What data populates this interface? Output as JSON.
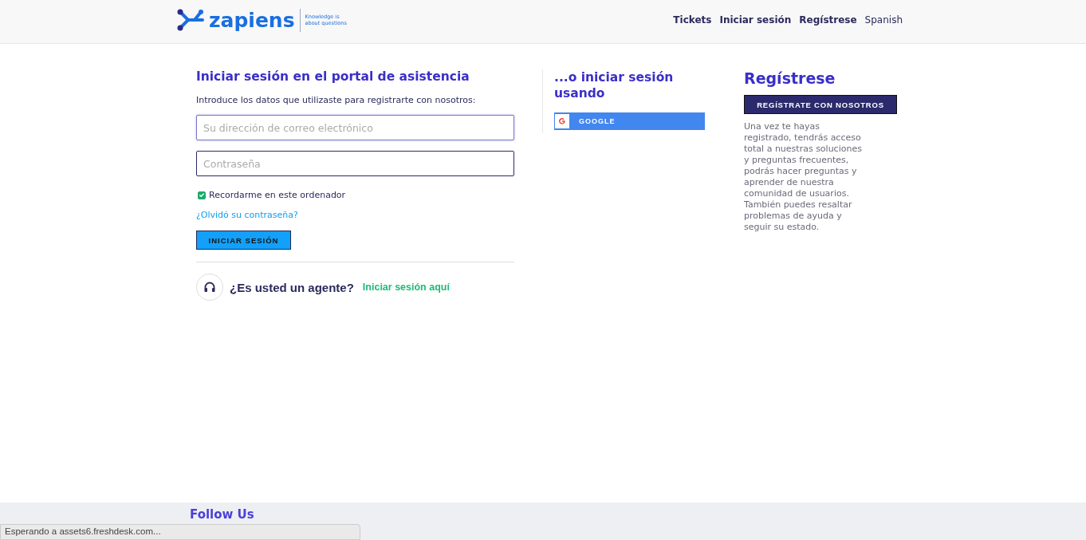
{
  "header": {
    "logo": {
      "name": "zapiens",
      "tagline": [
        "Knowledge is",
        "about questions"
      ]
    },
    "nav": [
      {
        "label": "Tickets",
        "kind": "link"
      },
      {
        "label": "Iniciar sesión",
        "kind": "link"
      },
      {
        "label": "Regístrese",
        "kind": "link"
      },
      {
        "label": "Spanish",
        "kind": "language"
      }
    ]
  },
  "login": {
    "title": "Iniciar sesión en el portal de asistencia",
    "intro": "Introduce los datos que utilizaste para registrarte con nosotros:",
    "email": {
      "placeholder": "Su dirección de correo electrónico"
    },
    "password": {
      "placeholder": "Contraseña"
    },
    "remember": {
      "label": "Recordarme en este ordenador",
      "checked": true
    },
    "forgot": "¿Olvidó su contraseña?",
    "submit": "INICIAR SESIÓN",
    "agent": {
      "question": "¿Es usted un agente?",
      "link": "Iniciar sesión aquí"
    }
  },
  "social": {
    "title": "...o iniciar sesión usando",
    "buttons": [
      {
        "label": "GOOGLE"
      }
    ]
  },
  "signup": {
    "title": "Regístrese",
    "button": "REGÍSTRATE CON NOSOTROS",
    "text": "Una vez te hayas registrado, tendrás acceso total a nuestras soluciones y preguntas frecuentes, podrás hacer preguntas y aprender de nuestra comunidad de usuarios. También puedes resaltar problemas de ayuda y seguir su estado."
  },
  "footer": {
    "title": "Follow Us"
  },
  "status_bar": "Esperando a assets6.freshdesk.com..."
}
